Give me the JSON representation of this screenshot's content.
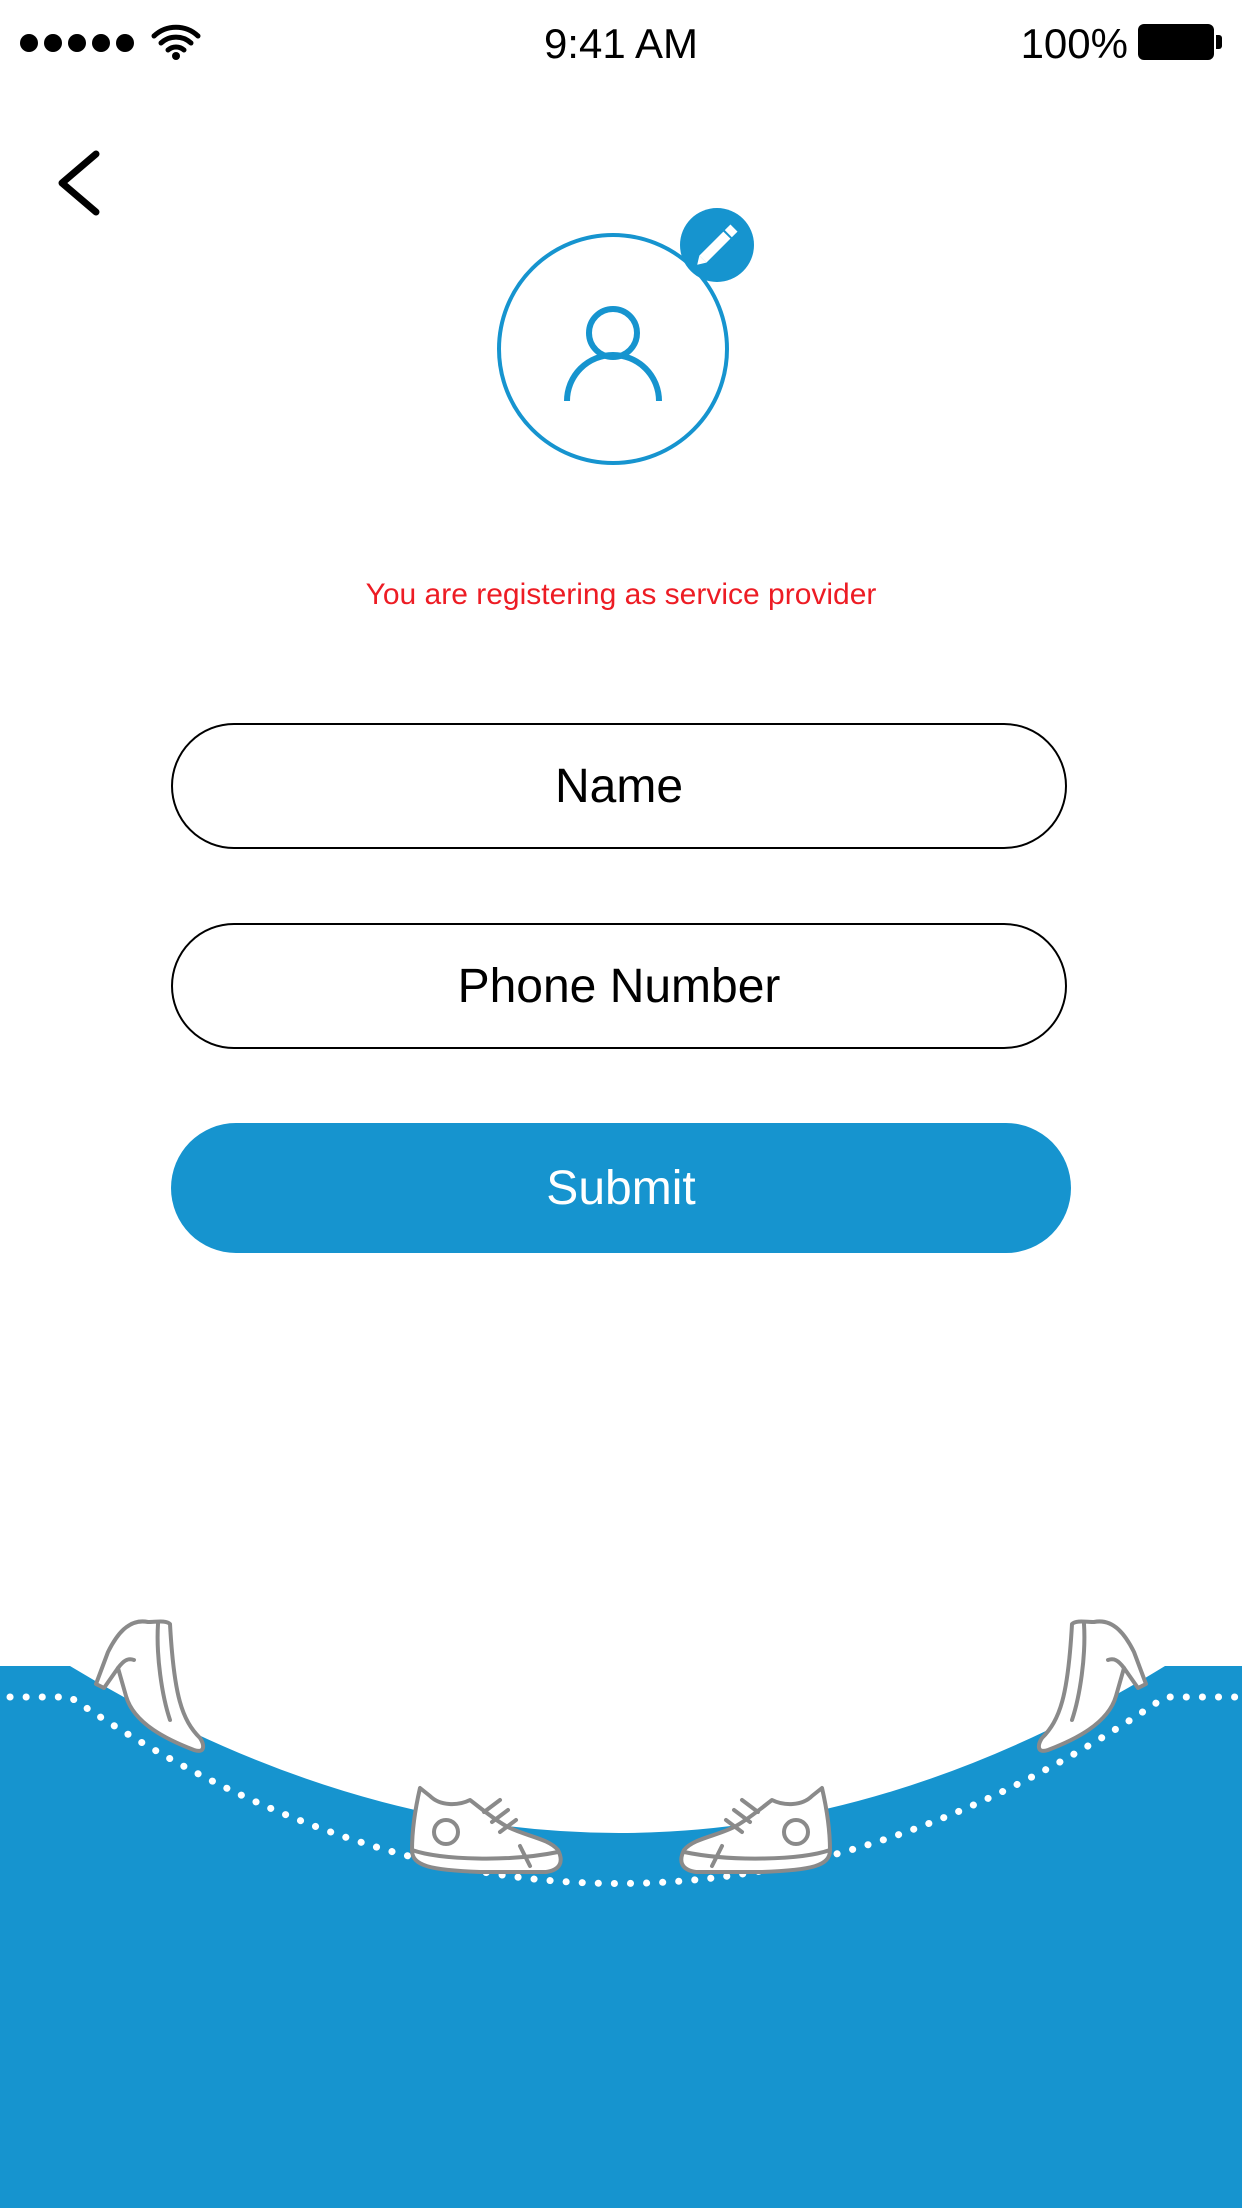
{
  "status_bar": {
    "time": "9:41 AM",
    "battery_percent": "100%",
    "signal_bars": 5,
    "icons": [
      "signal-dots-icon",
      "wifi-icon",
      "battery-icon"
    ]
  },
  "nav": {
    "back_icon": "chevron-left-icon"
  },
  "profile": {
    "avatar_icon": "user-icon",
    "edit_icon": "pencil-icon"
  },
  "notice": "You are registering as service provider",
  "form": {
    "name_placeholder": "Name",
    "phone_placeholder": "Phone Number",
    "submit_label": "Submit"
  },
  "decor": {
    "icons": [
      "high-heel-icon",
      "sneaker-icon"
    ]
  },
  "colors": {
    "accent": "#1694CF",
    "notice": "#ED1C24",
    "background": "#FFFFFF",
    "text": "#000000",
    "shoe_outline": "#8A8A8A"
  }
}
